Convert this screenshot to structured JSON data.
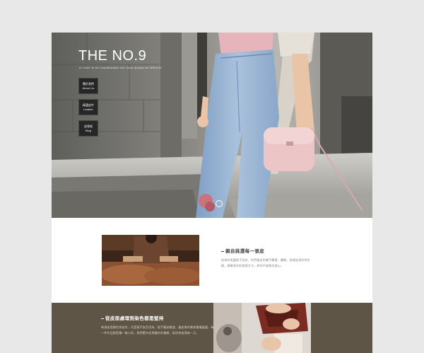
{
  "hero": {
    "title": "THE NO.9",
    "tagline": "In order to be irreplaceable one must always be different"
  },
  "nav": [
    {
      "zh": "關於我們",
      "en": "About Us"
    },
    {
      "zh": "精選皮件",
      "en": "Leather"
    },
    {
      "zh": "部落格",
      "en": "Blog"
    }
  ],
  "section_craft": {
    "title": "親自挑選每一張皮",
    "body": "皮革的挑選極不容易，你們親自用雙手觸摸，體驗，依據皮革的的外觀，做最適合的處理方式，原則不能輕忽處心。"
  },
  "section_dye": {
    "title": "從皮面處理到染色都是堅持",
    "body": "每張皮面顏色與染色，均是親手染色而成，經手翻染數週，讓皮質的質感慢慢展露，每一件作品都是獨一無二的，我們堅持呈現最好的樣貌，陪伴你度過每一天。"
  },
  "colors": {
    "page_bg": "#e8e8e8",
    "nav_box": "#262626",
    "accent_brown": "#5f5546"
  }
}
